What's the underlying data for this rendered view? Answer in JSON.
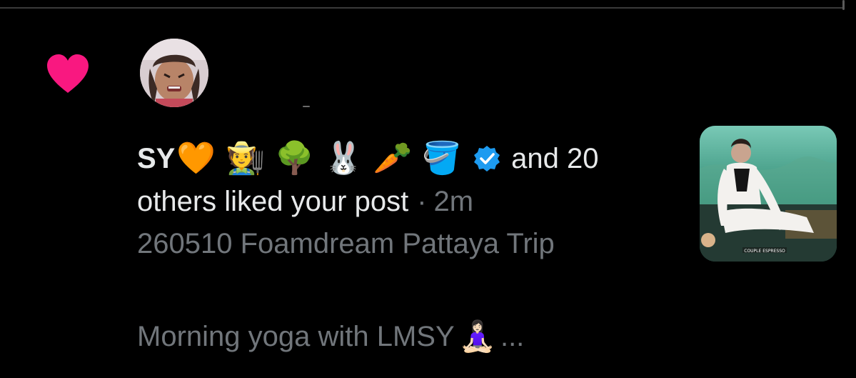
{
  "notification": {
    "type": "like",
    "user_name": "SY",
    "name_emojis": [
      "🧡",
      "🧑‍🌾",
      "🌳",
      "🐰",
      "🥕",
      "🪣"
    ],
    "others_prefix": "and 20",
    "others_suffix": "others liked your post",
    "separator": "·",
    "time": "2m",
    "post_title": "260510 Foamdream Pattaya Trip",
    "post_text": "Morning yoga with LMSY",
    "post_emoji": "🧘🏻‍♀️",
    "ellipsis": "...",
    "thumbnail_caption": "COUPLE ESPRESSO"
  },
  "icons": {
    "heart": "heart-icon",
    "verified": "verified-badge-icon"
  },
  "colors": {
    "background": "#000000",
    "primary_text": "#e7e9ea",
    "secondary_text": "#71767b",
    "heart": "#f91880",
    "verified": "#1d9bf0"
  }
}
